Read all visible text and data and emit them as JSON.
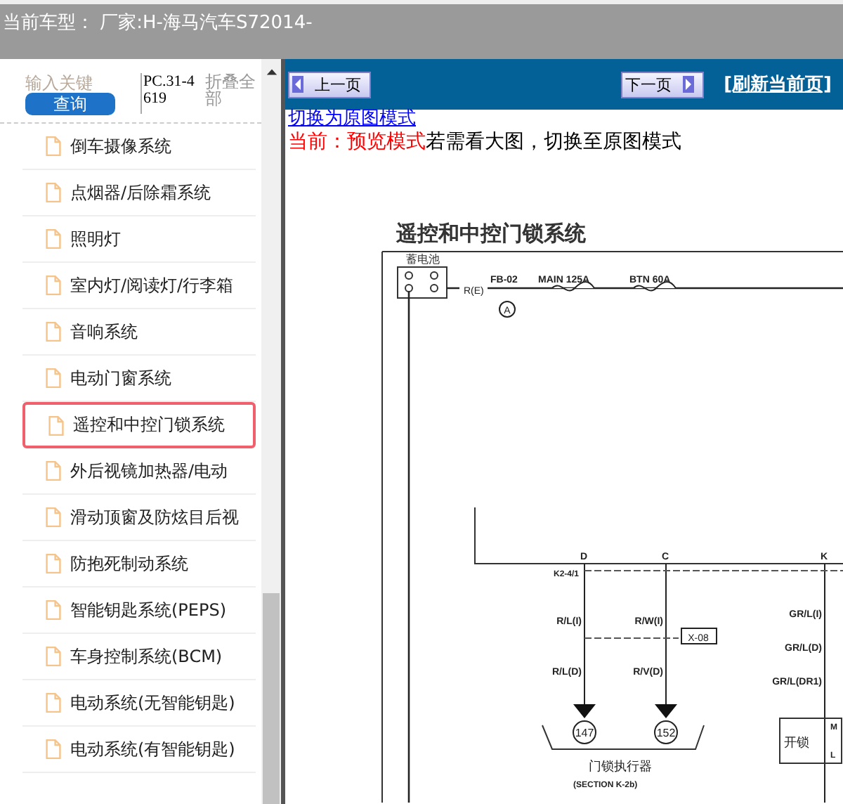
{
  "header": {
    "title": "当前车型： 厂家:H-海马汽车S72014-"
  },
  "sidebar": {
    "search": {
      "placeholder": "输入关键",
      "button": "查询"
    },
    "code": "PC.31-4619",
    "collapse_all": "折叠全部",
    "items": [
      {
        "label": "倒车摄像系统",
        "selected": false
      },
      {
        "label": "点烟器/后除霜系统",
        "selected": false
      },
      {
        "label": "照明灯",
        "selected": false
      },
      {
        "label": "室内灯/阅读灯/行李箱",
        "selected": false
      },
      {
        "label": "音响系统",
        "selected": false
      },
      {
        "label": "电动门窗系统",
        "selected": false
      },
      {
        "label": "遥控和中控门锁系统",
        "selected": true
      },
      {
        "label": "外后视镜加热器/电动",
        "selected": false
      },
      {
        "label": "滑动顶窗及防炫目后视",
        "selected": false
      },
      {
        "label": "防抱死制动系统",
        "selected": false
      },
      {
        "label": "智能钥匙系统(PEPS)",
        "selected": false
      },
      {
        "label": "车身控制系统(BCM)",
        "selected": false
      },
      {
        "label": "电动系统(无智能钥匙)",
        "selected": false
      },
      {
        "label": "电动系统(有智能钥匙)",
        "selected": false
      }
    ]
  },
  "toolbar": {
    "prev": "上一页",
    "next": "下一页",
    "refresh": "[刷新当前页]"
  },
  "mode": {
    "link": "切换为原图模式",
    "current": "当前：预览模式",
    "hint": "若需看大图，切换至原图模式"
  },
  "diagram": {
    "title": "遥控和中控门锁系统",
    "battery": "蓄电池",
    "wire_re": "R(E)",
    "fb": "FB-02",
    "circle_a": "A",
    "main_fuse": "MAIN 125A",
    "btn_fuse": "BTN 60A",
    "pin_d": "D",
    "pin_c": "C",
    "pin_k": "K",
    "connector": "K2-4/1",
    "rl_i": "R/L(I)",
    "rw_i": "R/W(I)",
    "x08": "X-08",
    "rl_d": "R/L(D)",
    "rv_d": "R/V(D)",
    "grl_i": "GR/L(I)",
    "grl_d": "GR/L(D)",
    "grl_dr1": "GR/L(DR1)",
    "ground_1": "147",
    "ground_2": "152",
    "actuator": "门锁执行器",
    "section": "(SECTION K-2b)",
    "unlock": "开锁",
    "m": "M",
    "l": "L"
  }
}
